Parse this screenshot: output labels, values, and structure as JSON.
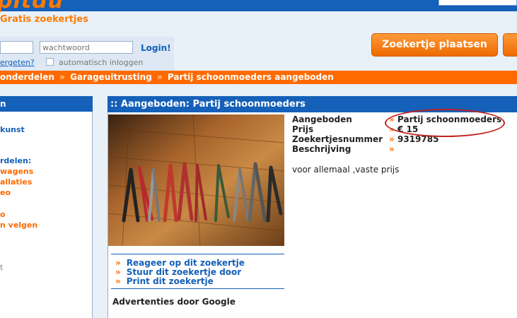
{
  "header": {
    "logo_text": "pitdu",
    "tagline": "Gratis zoekertjes"
  },
  "login": {
    "password_placeholder": "wachtwoord",
    "login_label": "Login!",
    "forgot_label": "ergeten?",
    "auto_login_label": "automatisch inloggen"
  },
  "actions": {
    "place_ad_label": "Zoekertje plaatsen"
  },
  "breadcrumb": {
    "items": [
      "onderdelen",
      "Garageuitrusting",
      "Partij schoonmoeders aangeboden"
    ],
    "separator": "»"
  },
  "sidebar": {
    "header": "n",
    "items": [
      {
        "label": "kunst",
        "color": "#1560b8"
      },
      {
        "label": "rdelen:",
        "color": "#1560b8"
      },
      {
        "label": "wagens",
        "color": "#ff6a00"
      },
      {
        "label": "allaties",
        "color": "#ff6a00"
      },
      {
        "label": "eo",
        "color": "#ff6a00"
      },
      {
        "label": "o",
        "color": "#ff6a00"
      },
      {
        "label": "n velgen",
        "color": "#ff6a00"
      },
      {
        "label": "t",
        "color": "#ff6a00"
      }
    ]
  },
  "ad": {
    "title": ":: Aangeboden: Partij schoonmoeders",
    "fields": [
      {
        "label": "Aangeboden",
        "value": "Partij schoonmoeders"
      },
      {
        "label": "Prijs",
        "value": "€ 15"
      },
      {
        "label": "Zoekertjesnummer",
        "value": "9319785"
      },
      {
        "label": "Beschrijving",
        "value": ""
      }
    ],
    "arrow": "»",
    "description": "voor allemaal ,vaste prijs",
    "links": [
      "Reageer op dit zoekertje",
      "Stuur dit zoekertje door",
      "Print dit zoekertje"
    ],
    "google_label": "Advertenties door Google"
  },
  "colors": {
    "brand_blue": "#1560b8",
    "brand_orange": "#ff6a00",
    "annotation_red": "#c02020"
  }
}
